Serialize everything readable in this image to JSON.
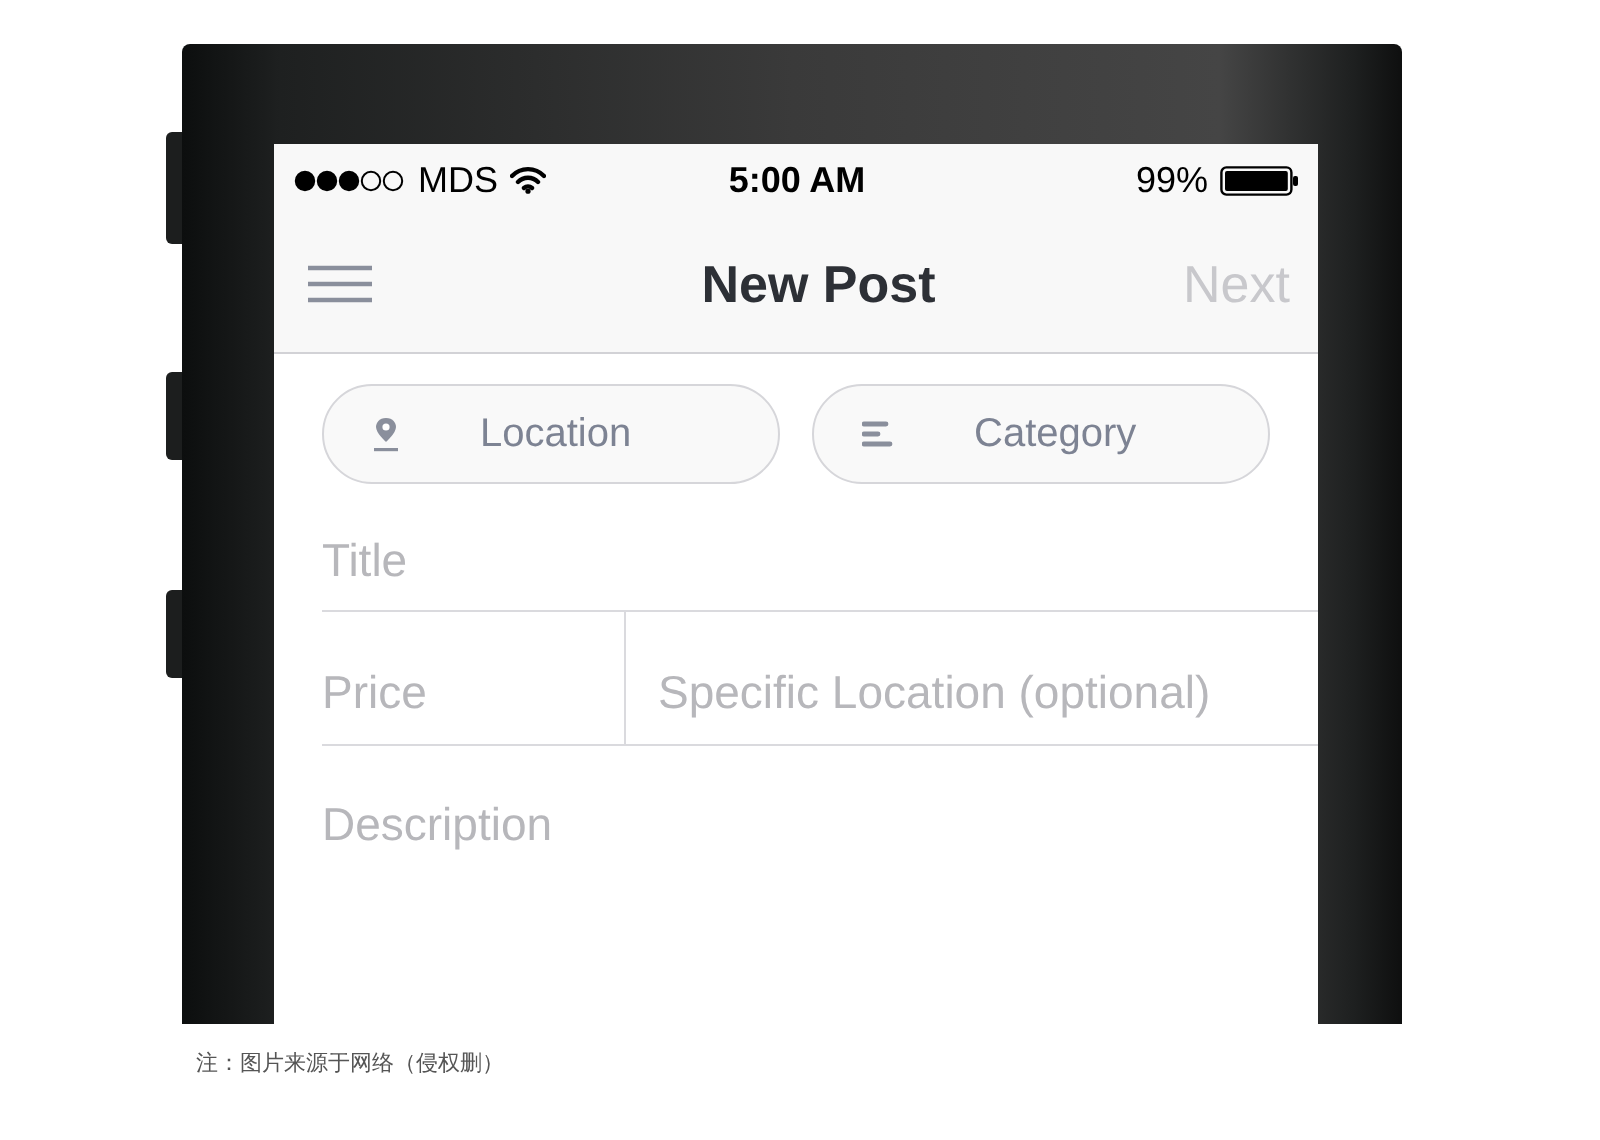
{
  "status_bar": {
    "carrier": "MDS",
    "time": "5:00 AM",
    "battery": "99%"
  },
  "nav_bar": {
    "title": "New Post",
    "next": {
      "label": "Next",
      "disabled": true
    }
  },
  "pickers": [
    {
      "kind": "location",
      "label": "Location"
    },
    {
      "kind": "category",
      "label": "Category"
    }
  ],
  "fields": {
    "title": {
      "placeholder": "Title"
    },
    "price": {
      "placeholder": "Price"
    },
    "specific_location": {
      "placeholder": "Specific Location (optional)"
    },
    "description": {
      "placeholder": "Description"
    }
  },
  "caption": "注：图片来源于网络（侵权删）"
}
